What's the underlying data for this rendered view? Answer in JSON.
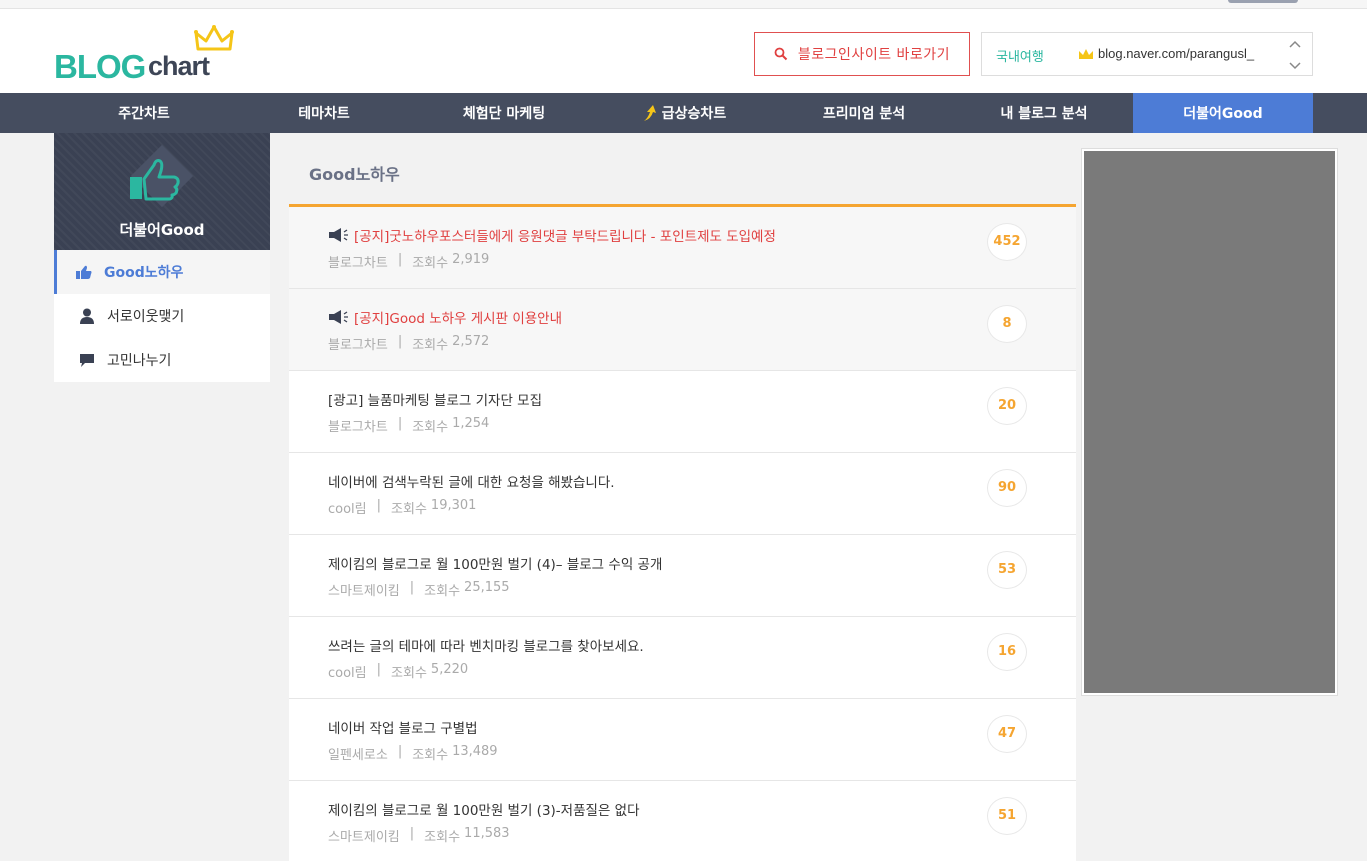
{
  "header": {
    "logo": {
      "part1": "BLOG",
      "part2": "chart"
    },
    "insite_button": "블로그인사이트 바로가기",
    "blog_select": {
      "category": "국내여행",
      "url": "blog.naver.com/parangusl_"
    }
  },
  "nav": {
    "items": [
      {
        "label": "주간차트"
      },
      {
        "label": "테마차트"
      },
      {
        "label": "체험단 마케팅"
      },
      {
        "label": "급상승차트"
      },
      {
        "label": "프리미엄 분석"
      },
      {
        "label": "내 블로그 분석"
      },
      {
        "label": "더불어Good"
      }
    ],
    "active_color": "#4d7cd6"
  },
  "sidebar": {
    "title": "더불어Good",
    "items": [
      {
        "label": "Good노하우",
        "icon": "thumbs-up-icon"
      },
      {
        "label": "서로이웃맺기",
        "icon": "person-icon"
      },
      {
        "label": "고민나누기",
        "icon": "chat-icon"
      }
    ]
  },
  "main": {
    "title": "Good노하우",
    "views_label": "조회수",
    "posts": [
      {
        "title": "[공지]굿노하우포스터들에게 응원댓글 부탁드립니다 - 포인트제도 도입예정",
        "author": "블로그차트",
        "views": "2,919",
        "comments": "452",
        "notice": true
      },
      {
        "title": "[공지]Good 노하우 게시판 이용안내",
        "author": "블로그차트",
        "views": "2,572",
        "comments": "8",
        "notice": true
      },
      {
        "title": "[광고] 늘품마케팅 블로그 기자단 모집",
        "author": "블로그차트",
        "views": "1,254",
        "comments": "20",
        "notice": false
      },
      {
        "title": "네이버에 검색누락된 글에 대한 요청을 해봤습니다.",
        "author": "cool림",
        "views": "19,301",
        "comments": "90",
        "notice": false
      },
      {
        "title": "제이킴의 블로그로 월 100만원 벌기 (4)– 블로그 수익 공개",
        "author": "스마트제이킴",
        "views": "25,155",
        "comments": "53",
        "notice": false
      },
      {
        "title": "쓰려는 글의 테마에 따라 벤치마킹 블로그를 찾아보세요.",
        "author": "cool림",
        "views": "5,220",
        "comments": "16",
        "notice": false
      },
      {
        "title": "네이버 작업 블로그 구별법",
        "author": "일펜세로소",
        "views": "13,489",
        "comments": "47",
        "notice": false
      },
      {
        "title": "제이킴의 블로그로 월 100만원 벌기 (3)-저품질은 없다",
        "author": "스마트제이킴",
        "views": "11,583",
        "comments": "51",
        "notice": false
      }
    ]
  },
  "colors": {
    "brand_teal": "#2bb7a0",
    "nav_bg": "#454d5f",
    "accent_orange": "#f5a531",
    "notice_red": "#e04040"
  }
}
